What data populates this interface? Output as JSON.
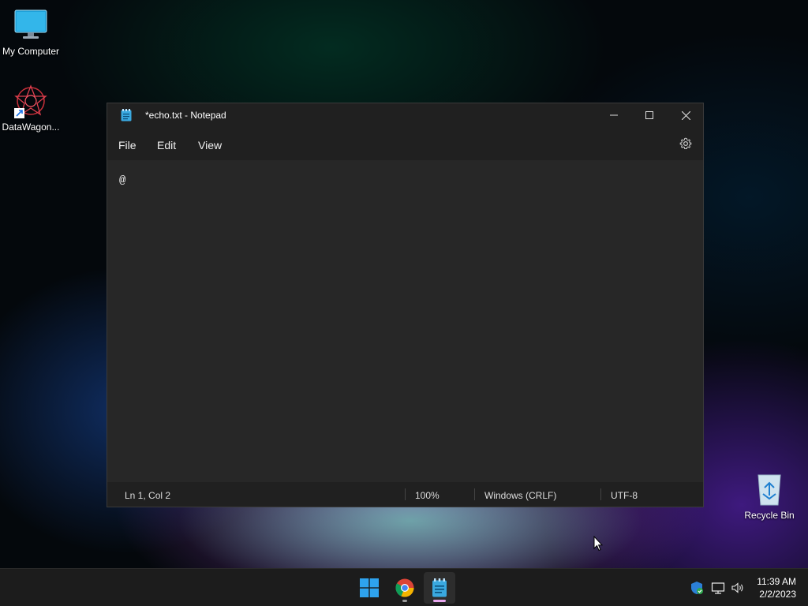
{
  "desktop": {
    "icons": [
      {
        "label": "My Computer",
        "icon": "monitor-icon"
      },
      {
        "label": "DataWagon...",
        "icon": "datawagon-shortcut-icon"
      },
      {
        "label": "Recycle Bin",
        "icon": "recycle-bin-icon"
      }
    ]
  },
  "notepad": {
    "title": "*echo.txt - Notepad",
    "menu": [
      "File",
      "Edit",
      "View"
    ],
    "content": "@",
    "status": {
      "position": "Ln 1, Col 2",
      "zoom": "100%",
      "line_ending": "Windows (CRLF)",
      "encoding": "UTF-8"
    }
  },
  "taskbar": {
    "apps": [
      {
        "name": "Start",
        "icon": "windows-start-icon"
      },
      {
        "name": "Google Chrome",
        "icon": "chrome-icon"
      },
      {
        "name": "Notepad",
        "icon": "notepad-icon",
        "active": true
      }
    ],
    "tray": [
      "security-icon",
      "network-icon",
      "volume-icon"
    ],
    "time": "11:39 AM",
    "date": "2/2/2023"
  },
  "colors": {
    "accent": "#0078d4",
    "window_bg": "#202020",
    "editor_bg": "#272727"
  }
}
